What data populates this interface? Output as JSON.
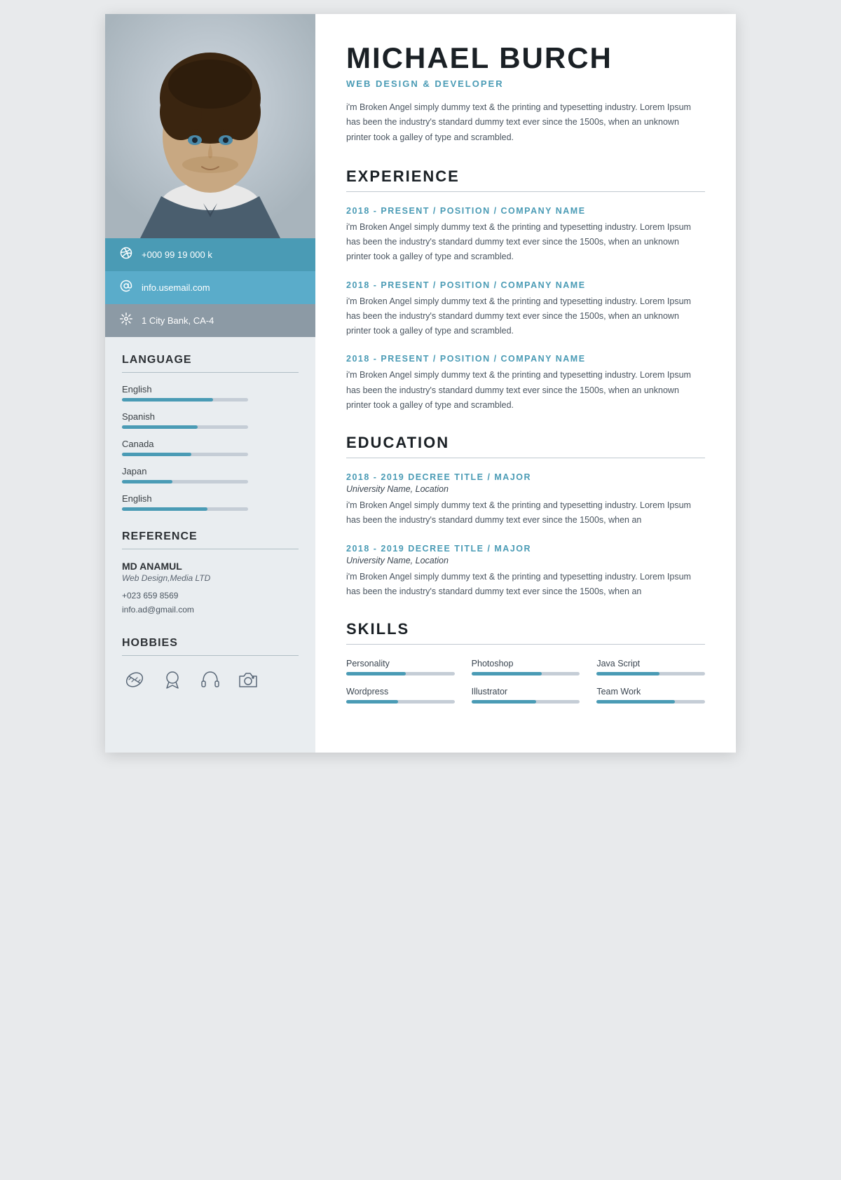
{
  "person": {
    "name": "MICHAEL BURCH",
    "title": "WEB DESIGN & DEVELOPER",
    "intro": "i'm Broken Angel simply dummy text & the printing and typesetting industry. Lorem Ipsum has been the industry's standard dummy text ever since the 1500s, when an unknown printer took a galley of type and scrambled."
  },
  "contact": [
    {
      "icon": "phone",
      "value": "+000 99 19 000 k"
    },
    {
      "icon": "email",
      "value": "info.usemail.com"
    },
    {
      "icon": "location",
      "value": "1 City Bank, CA-4"
    }
  ],
  "language": {
    "title": "LANGUAGE",
    "items": [
      {
        "name": "English",
        "pct": 72
      },
      {
        "name": "Spanish",
        "pct": 60
      },
      {
        "name": "Canada",
        "pct": 55
      },
      {
        "name": "Japan",
        "pct": 40
      },
      {
        "name": "English",
        "pct": 68
      }
    ]
  },
  "reference": {
    "title": "REFERENCE",
    "name": "MD ANAMUL",
    "role": "Web Design,Media LTD",
    "phone": "+023 659 8569",
    "email": "info.ad@gmail.com"
  },
  "hobbies": {
    "title": "HOBBIES",
    "items": [
      "football",
      "award",
      "headphone",
      "camera"
    ]
  },
  "experience": {
    "title": "EXPERIENCE",
    "items": [
      {
        "period": "2018 - PRESENT / POSITION / COMPANY NAME",
        "desc": "i'm Broken Angel simply dummy text & the printing and typesetting industry. Lorem Ipsum has been the industry's standard dummy text ever since the 1500s, when an unknown printer took a galley of type and scrambled."
      },
      {
        "period": "2018 - PRESENT / POSITION / COMPANY NAME",
        "desc": "i'm Broken Angel simply dummy text & the printing and typesetting industry. Lorem Ipsum has been the industry's standard dummy text ever since the 1500s, when an unknown printer took a galley of type and scrambled."
      },
      {
        "period": "2018 - PRESENT / POSITION / COMPANY NAME",
        "desc": "i'm Broken Angel simply dummy text & the printing and typesetting industry. Lorem Ipsum has been the industry's standard dummy text ever since the 1500s, when an unknown printer took a galley of type and scrambled."
      }
    ]
  },
  "education": {
    "title": "EDUCATION",
    "items": [
      {
        "degree": "2018 - 2019 DECREE TITLE / MAJOR",
        "university": "University Name, Location",
        "desc": "i'm Broken Angel simply dummy text & the printing and typesetting industry. Lorem Ipsum has been the industry's standard dummy text ever since the 1500s, when an"
      },
      {
        "degree": "2018 - 2019 DECREE TITLE / MAJOR",
        "university": "University Name, Location",
        "desc": "i'm Broken Angel simply dummy text & the printing and typesetting industry. Lorem Ipsum has been the industry's standard dummy text ever since the 1500s, when an"
      }
    ]
  },
  "skills": {
    "title": "SKILLS",
    "items": [
      {
        "name": "Personality",
        "pct": 55
      },
      {
        "name": "Photoshop",
        "pct": 65
      },
      {
        "name": "Java Script",
        "pct": 58
      },
      {
        "name": "Wordpress",
        "pct": 48
      },
      {
        "name": "Illustrator",
        "pct": 60
      },
      {
        "name": "Team Work",
        "pct": 72
      }
    ]
  }
}
